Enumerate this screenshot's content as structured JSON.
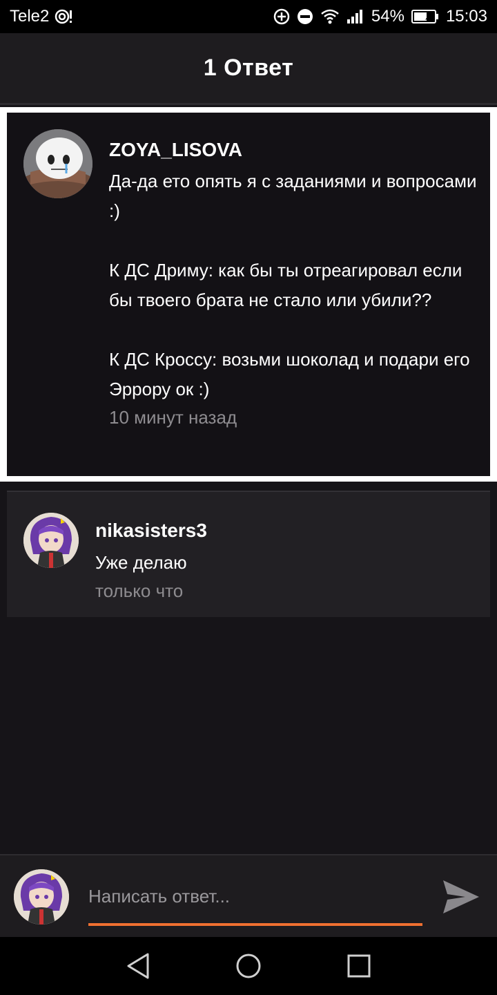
{
  "status_bar": {
    "carrier": "Tele2",
    "battery": "54%",
    "time": "15:03"
  },
  "header": {
    "title": "1 Ответ"
  },
  "parent_comment": {
    "author": "ZOYA_LISOVA",
    "text": "Да-да ето опять я с заданиями и вопросами :)\n\nК ДС Дриму: как бы ты отреагировал если бы твоего брата не стало или убили??\n\nК ДС Кроссу: возьми шоколад и подари его Эррору ок :)",
    "time": "10 минут назад"
  },
  "reply": {
    "author": "nikasisters3",
    "text": "Уже делаю",
    "time": "только что"
  },
  "composer": {
    "placeholder": "Написать ответ..."
  },
  "colors": {
    "accent": "#f07030",
    "background": "#161418",
    "card": "#222024"
  }
}
